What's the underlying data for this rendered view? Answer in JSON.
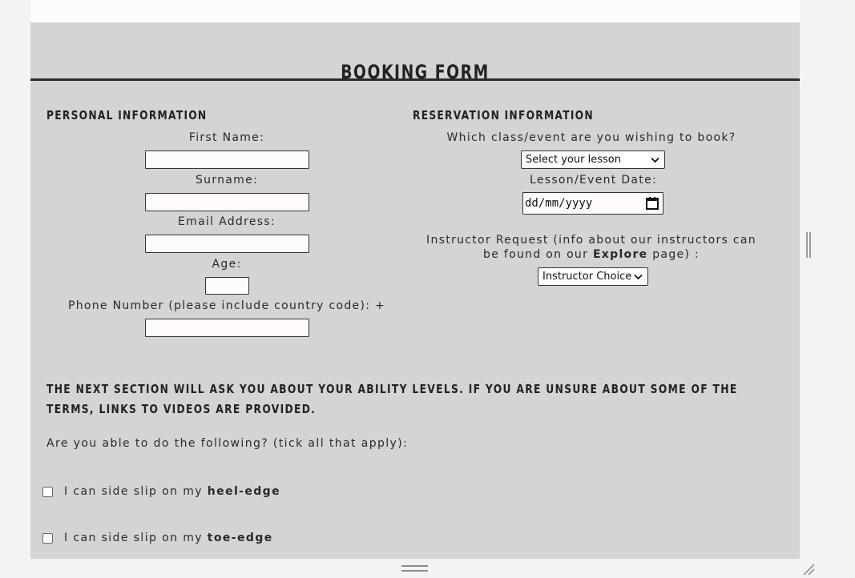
{
  "form": {
    "title": "BOOKING FORM"
  },
  "personal": {
    "heading": "PERSONAL INFORMATION",
    "first_name_label": "First Name:",
    "surname_label": "Surname:",
    "email_label": "Email Address:",
    "age_label": "Age:",
    "phone_label": "Phone Number (please include country code): +"
  },
  "reservation": {
    "heading": "RESERVATION INFORMATION",
    "class_label": "Which class/event are you wishing to book?",
    "lesson_select": "Select your lesson",
    "date_label": "Lesson/Event Date:",
    "date_placeholder": "dd/mm/yyyy",
    "instructor_label_line1": "Instructor Request (info about our instructors can",
    "instructor_label_line2_pre": "be found on our",
    "instructor_label_link": "Explore",
    "instructor_label_line2_post": "page) :",
    "instructor_select": "Instructor Choice"
  },
  "ability": {
    "heading": "THE NEXT SECTION WILL ASK YOU ABOUT YOUR ABILITY LEVELS. IF YOU ARE UNSURE ABOUT SOME OF THE TERMS, LINKS TO VIDEOS ARE PROVIDED.",
    "question": "Are you able to do the following? (tick all that apply):",
    "options": [
      {
        "pre": "I can side slip on my",
        "term": "heel-edge",
        "checked": false
      },
      {
        "pre": "I can side slip on my",
        "term": "toe-edge",
        "checked": false
      }
    ]
  },
  "icons": {
    "select_chevron": "chevron-down-icon",
    "date_picker": "calendar-icon"
  }
}
